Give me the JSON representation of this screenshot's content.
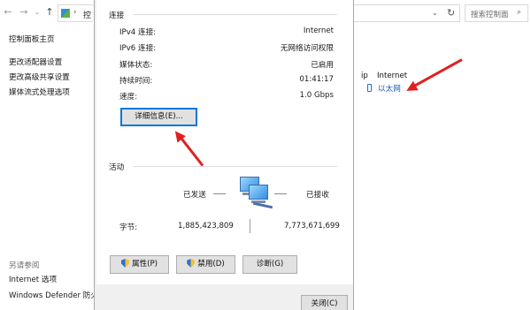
{
  "background": {
    "nav": {
      "back": "←",
      "forward": "→",
      "dropdown": "⌄",
      "up": "↑",
      "refresh": "↻",
      "separator": "›"
    },
    "address_fragment": "控",
    "search_placeholder": "搜索控制面",
    "search_icon": "⌕",
    "sidebar": {
      "items": [
        "控制面板主页",
        "更改适配器设置",
        "更改高级共享设置",
        "媒体流式处理选项"
      ],
      "see_also_title": "另请参阅",
      "see_also": [
        "Internet 选项",
        "Windows Defender 防火"
      ]
    },
    "connection": {
      "access_type": "Internet",
      "access_prefix": "ip",
      "link_label": "以太网"
    }
  },
  "dialog": {
    "connection_title": "连接",
    "rows": [
      {
        "label": "IPv4 连接:",
        "value": "Internet"
      },
      {
        "label": "IPv6 连接:",
        "value": "无网络访问权限"
      },
      {
        "label": "媒体状态:",
        "value": "已启用"
      },
      {
        "label": "持续时间:",
        "value": "01:41:17"
      },
      {
        "label": "速度:",
        "value": "1.0 Gbps"
      }
    ],
    "details_button": "详细信息(E)...",
    "activity_title": "活动",
    "sent_label": "已发送",
    "received_label": "已接收",
    "bytes_label": "字节:",
    "bytes_sent": "1,885,423,809",
    "bytes_received": "7,773,671,699",
    "properties_button": "属性(P)",
    "disable_button": "禁用(D)",
    "diagnose_button": "诊断(G)",
    "close_button": "关闭(C)"
  },
  "colors": {
    "arrow": "#e02020",
    "link": "#1a5fb4",
    "focus": "#0078d7"
  },
  "icons": [
    "back-arrow-icon",
    "forward-arrow-icon",
    "up-arrow-icon",
    "control-panel-icon",
    "refresh-icon",
    "search-icon",
    "ethernet-plug-icon",
    "network-computers-icon",
    "shield-icon"
  ]
}
